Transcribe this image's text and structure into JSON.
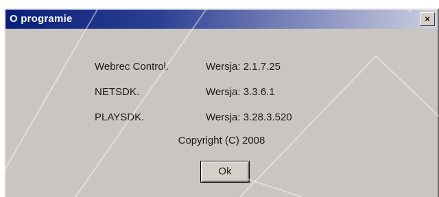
{
  "dialog": {
    "title": "O programie",
    "close_label": "×"
  },
  "components": [
    {
      "name": "Webrec Control.",
      "version": "Wersja: 2.1.7.25"
    },
    {
      "name": "NETSDK.",
      "version": "Wersja: 3.3.6.1"
    },
    {
      "name": "PLAYSDK.",
      "version": "Wersja: 3.28.3.520"
    }
  ],
  "copyright": "Copyright (C) 2008",
  "ok_label": "Ok",
  "colors": {
    "title_bar_start": "#0a1f7a",
    "dialog_background": "#c9c5c1"
  }
}
